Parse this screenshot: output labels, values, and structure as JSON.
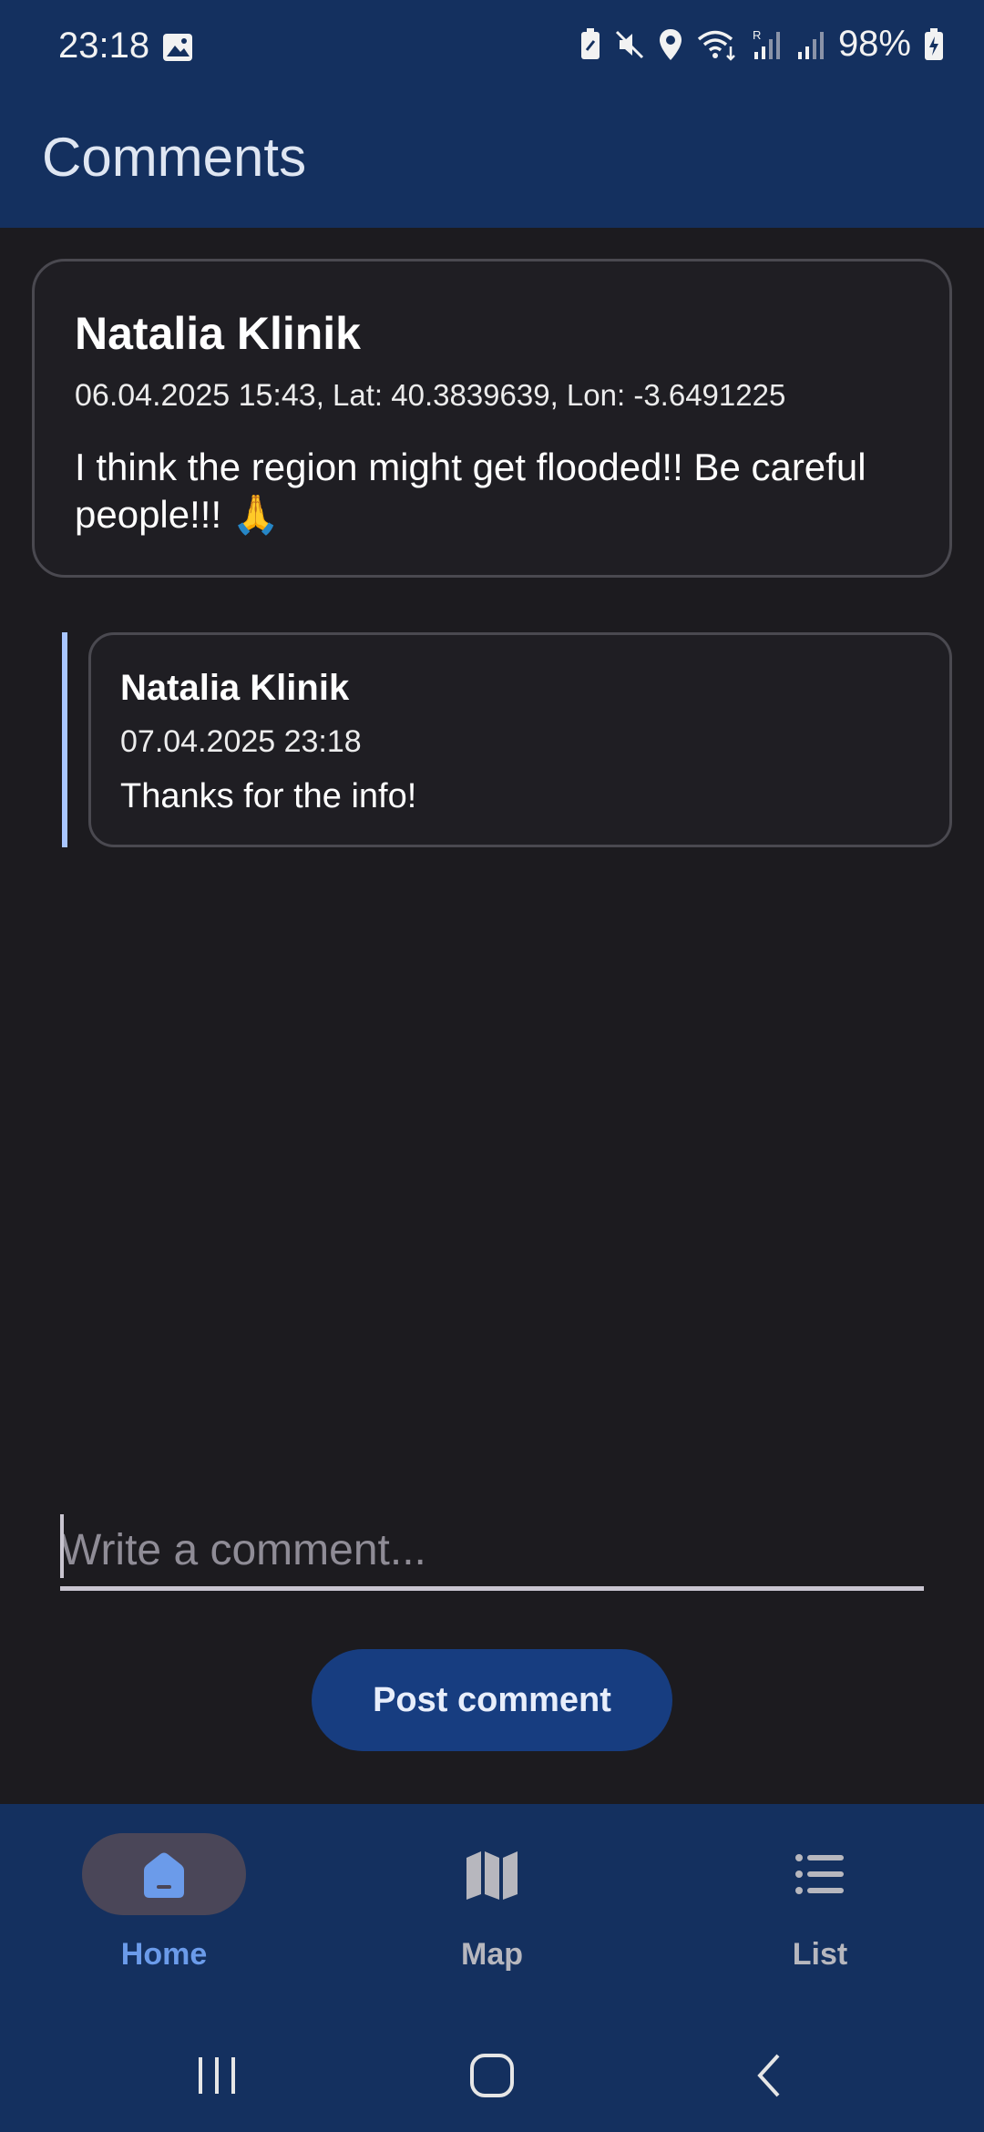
{
  "status_bar": {
    "time": "23:18",
    "battery": "98%",
    "icons": [
      "gallery-icon",
      "battery-saver-icon",
      "mute-icon",
      "location-icon",
      "wifi-icon",
      "signal-r-icon",
      "signal-icon",
      "battery-charging-icon"
    ]
  },
  "app_bar": {
    "title": "Comments"
  },
  "main_comment": {
    "author": "Natalia Klinik",
    "date": "06.04.2025 15:43",
    "location": ", Lat: 40.3839639, Lon: -3.6491225",
    "text": "I think the region might get flooded!! Be careful people!!! 🙏"
  },
  "reply": {
    "author": "Natalia Klinik",
    "date": "07.04.2025 23:18",
    "text": "Thanks for the info!"
  },
  "composer": {
    "placeholder": "Write a comment...",
    "value": "",
    "button_label": "Post comment"
  },
  "bottom_nav": {
    "items": [
      {
        "label": "Home",
        "icon": "home-icon",
        "active": true
      },
      {
        "label": "Map",
        "icon": "map-icon",
        "active": false
      },
      {
        "label": "List",
        "icon": "list-icon",
        "active": false
      }
    ]
  },
  "colors": {
    "bar_bg": "#14305f",
    "content_bg": "#1c1b1f",
    "accent": "#a9c6ff",
    "active_nav": "#6b9bea",
    "inactive_nav": "#b7b7be",
    "button_bg": "#173d80"
  }
}
